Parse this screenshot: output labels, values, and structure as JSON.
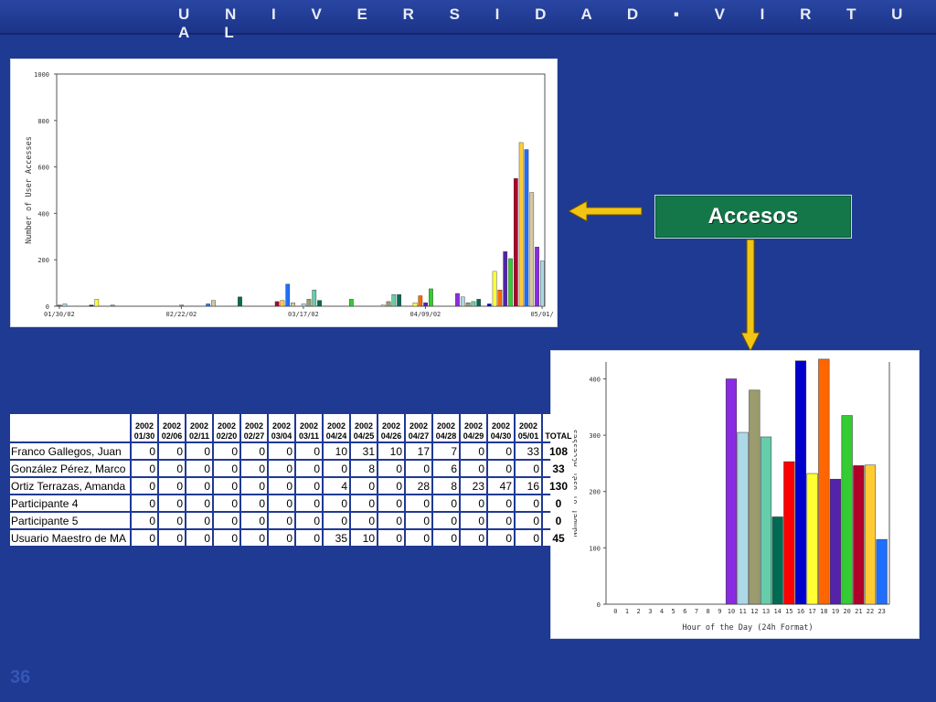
{
  "header": {
    "brand": "U N I V E R S I D A D  ▪  V I R T U A L"
  },
  "button": {
    "label": "Accesos"
  },
  "slide": {
    "number": "36"
  },
  "colors": {
    "background": "#1f3a93",
    "arrow": "#f2c413",
    "button": "#14774a"
  },
  "table": {
    "columns": [
      {
        "year": "2002",
        "date": "01/30"
      },
      {
        "year": "2002",
        "date": "02/06"
      },
      {
        "year": "2002",
        "date": "02/11"
      },
      {
        "year": "2002",
        "date": "02/20"
      },
      {
        "year": "2002",
        "date": "02/27"
      },
      {
        "year": "2002",
        "date": "03/04"
      },
      {
        "year": "2002",
        "date": "03/11"
      },
      {
        "year": "2002",
        "date": "04/24"
      },
      {
        "year": "2002",
        "date": "04/25"
      },
      {
        "year": "2002",
        "date": "04/26"
      },
      {
        "year": "2002",
        "date": "04/27"
      },
      {
        "year": "2002",
        "date": "04/28"
      },
      {
        "year": "2002",
        "date": "04/29"
      },
      {
        "year": "2002",
        "date": "04/30"
      },
      {
        "year": "2002",
        "date": "05/01"
      }
    ],
    "total_label": "TOTAL",
    "rows": [
      {
        "name": "Franco Gallegos, Juan",
        "values": [
          "0",
          "0",
          "0",
          "0",
          "0",
          "0",
          "0",
          "10",
          "31",
          "10",
          "17",
          "7",
          "0",
          "0",
          "33"
        ],
        "total": "108"
      },
      {
        "name": "González Pérez, Marco",
        "values": [
          "0",
          "0",
          "0",
          "0",
          "0",
          "0",
          "0",
          "0",
          "8",
          "0",
          "0",
          "6",
          "0",
          "0",
          "0"
        ],
        "total": "33"
      },
      {
        "name": "Ortiz Terrazas, Amanda",
        "values": [
          "0",
          "0",
          "0",
          "0",
          "0",
          "0",
          "0",
          "4",
          "0",
          "0",
          "28",
          "8",
          "23",
          "47",
          "16"
        ],
        "total": "130"
      },
      {
        "name": "Participante 4",
        "values": [
          "0",
          "0",
          "0",
          "0",
          "0",
          "0",
          "0",
          "0",
          "0",
          "0",
          "0",
          "0",
          "0",
          "0",
          "0"
        ],
        "total": "0"
      },
      {
        "name": "Participante 5",
        "values": [
          "0",
          "0",
          "0",
          "0",
          "0",
          "0",
          "0",
          "0",
          "0",
          "0",
          "0",
          "0",
          "0",
          "0",
          "0"
        ],
        "total": "0"
      },
      {
        "name": "Usuario Maestro de MA",
        "values": [
          "0",
          "0",
          "0",
          "0",
          "0",
          "0",
          "0",
          "35",
          "10",
          "0",
          "0",
          "0",
          "0",
          "0",
          "0"
        ],
        "total": "45"
      }
    ]
  },
  "chart_data": [
    {
      "type": "bar",
      "ylabel": "Number of User Accesses",
      "xlabel": "",
      "ylim": [
        0,
        1000
      ],
      "yticks": [
        "0",
        "200",
        "400",
        "600",
        "800",
        "1000"
      ],
      "xtick_labels": [
        "01/30/02",
        "02/22/02",
        "03/17/02",
        "04/09/02",
        "05/01/"
      ],
      "x_days": [
        0,
        1,
        2,
        3,
        4,
        5,
        6,
        7,
        8,
        9,
        10,
        11,
        12,
        13,
        14,
        15,
        16,
        17,
        18,
        19,
        20,
        21,
        22,
        23,
        24,
        25,
        26,
        27,
        28,
        29,
        30,
        31,
        32,
        33,
        34,
        35,
        36,
        37,
        38,
        39,
        40,
        41,
        42,
        43,
        44,
        45,
        46,
        47,
        48,
        49,
        50,
        51,
        52,
        53,
        54,
        55,
        56,
        57,
        58,
        59,
        60,
        61,
        62,
        63,
        64,
        65,
        66,
        67,
        68,
        69,
        70,
        71,
        72,
        73,
        74,
        75,
        76,
        77,
        78,
        79,
        80,
        81,
        82,
        83,
        84,
        85,
        86,
        87,
        88,
        89,
        90,
        91
      ],
      "values": [
        5,
        10,
        0,
        0,
        0,
        0,
        5,
        30,
        0,
        0,
        5,
        0,
        0,
        0,
        0,
        0,
        0,
        0,
        0,
        0,
        0,
        0,
        0,
        5,
        0,
        0,
        0,
        0,
        10,
        25,
        0,
        0,
        0,
        0,
        40,
        0,
        0,
        0,
        0,
        0,
        0,
        20,
        25,
        95,
        15,
        0,
        10,
        30,
        70,
        25,
        0,
        0,
        0,
        0,
        0,
        30,
        0,
        0,
        0,
        0,
        0,
        5,
        20,
        50,
        50,
        0,
        0,
        15,
        45,
        15,
        75,
        0,
        0,
        0,
        0,
        55,
        40,
        15,
        20,
        30,
        0,
        10,
        150,
        70,
        235,
        205,
        550,
        705,
        675,
        490,
        255,
        195
      ],
      "grid": false
    },
    {
      "type": "bar",
      "xlabel": "Hour of the Day (24h Format)",
      "ylabel": "Number of User Accesses",
      "ylim": [
        0,
        430
      ],
      "yticks": [
        "0",
        "100",
        "200",
        "300",
        "400"
      ],
      "categories": [
        "0",
        "1",
        "2",
        "3",
        "4",
        "5",
        "6",
        "7",
        "8",
        "9",
        "10",
        "11",
        "12",
        "13",
        "14",
        "15",
        "16",
        "17",
        "18",
        "19",
        "20",
        "21",
        "22",
        "23"
      ],
      "values": [
        0,
        0,
        0,
        0,
        0,
        0,
        0,
        0,
        0,
        0,
        400,
        305,
        380,
        297,
        155,
        253,
        432,
        232,
        435,
        222,
        335,
        246,
        247,
        115
      ],
      "bar_colors": [
        "#8a2be2",
        "#8a2be2",
        "#8a2be2",
        "#8a2be2",
        "#8a2be2",
        "#8a2be2",
        "#8a2be2",
        "#8a2be2",
        "#8a2be2",
        "#8a2be2",
        "#8a2be2",
        "#add8e6",
        "#9b9b6e",
        "#66cdaa",
        "#006b52",
        "#ff0000",
        "#0000cc",
        "#ffff33",
        "#ff6600",
        "#5522aa",
        "#33cc33",
        "#b0002a",
        "#ffcc33",
        "#1e6fff"
      ],
      "grid": false
    }
  ]
}
